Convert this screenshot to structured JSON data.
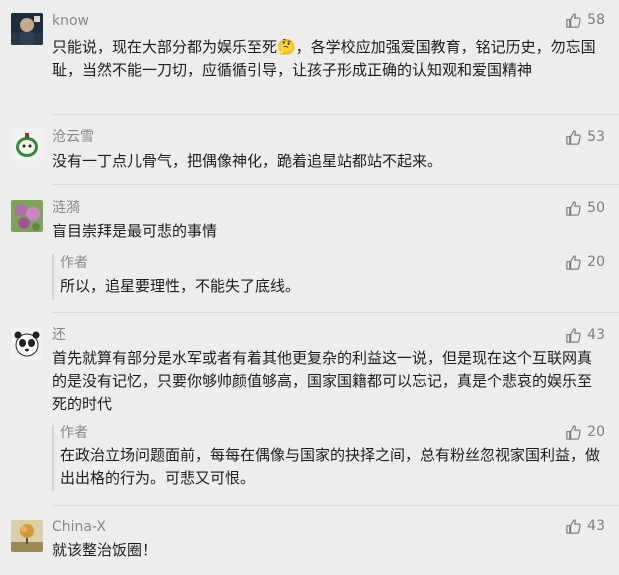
{
  "comments": [
    {
      "nickname": "know",
      "likes": "58",
      "text": "只能说，现在大部分都为娱乐至死🤔，各学校应加强爱国教育，铭记历史，勿忘国耻，当然不能一刀切，应循循引导，让孩子形成正确的认知观和爱国精神"
    },
    {
      "nickname": "沧云雪",
      "likes": "53",
      "text": "没有一丁点儿骨气，把偶像神化，跪着追星站都站不起来。"
    },
    {
      "nickname": "涟漪",
      "likes": "50",
      "text": "盲目崇拜是最可悲的事情",
      "reply": {
        "nickname": "作者",
        "likes": "20",
        "text": "所以，追星要理性，不能失了底线。"
      }
    },
    {
      "nickname": "还",
      "likes": "43",
      "text": "首先就算有部分是水军或者有着其他更复杂的利益这一说，但是现在这个互联网真的是没有记忆，只要你够帅颜值够高，国家国籍都可以忘记，真是个悲哀的娱乐至死的时代",
      "reply": {
        "nickname": "作者",
        "likes": "20",
        "text": "在政治立场问题面前，每每在偶像与国家的抉择之间，总有粉丝忽视家国利益，做出出格的行为。可悲又可恨。"
      }
    },
    {
      "nickname": "China-X",
      "likes": "43",
      "text": "就该整治饭圈！"
    }
  ],
  "icons": {
    "like": "thumbs-up-icon"
  },
  "colors": {
    "background": "#ededed",
    "nickname": "#888888",
    "text": "#1d1d1d",
    "likes": "#7e7e7e"
  }
}
